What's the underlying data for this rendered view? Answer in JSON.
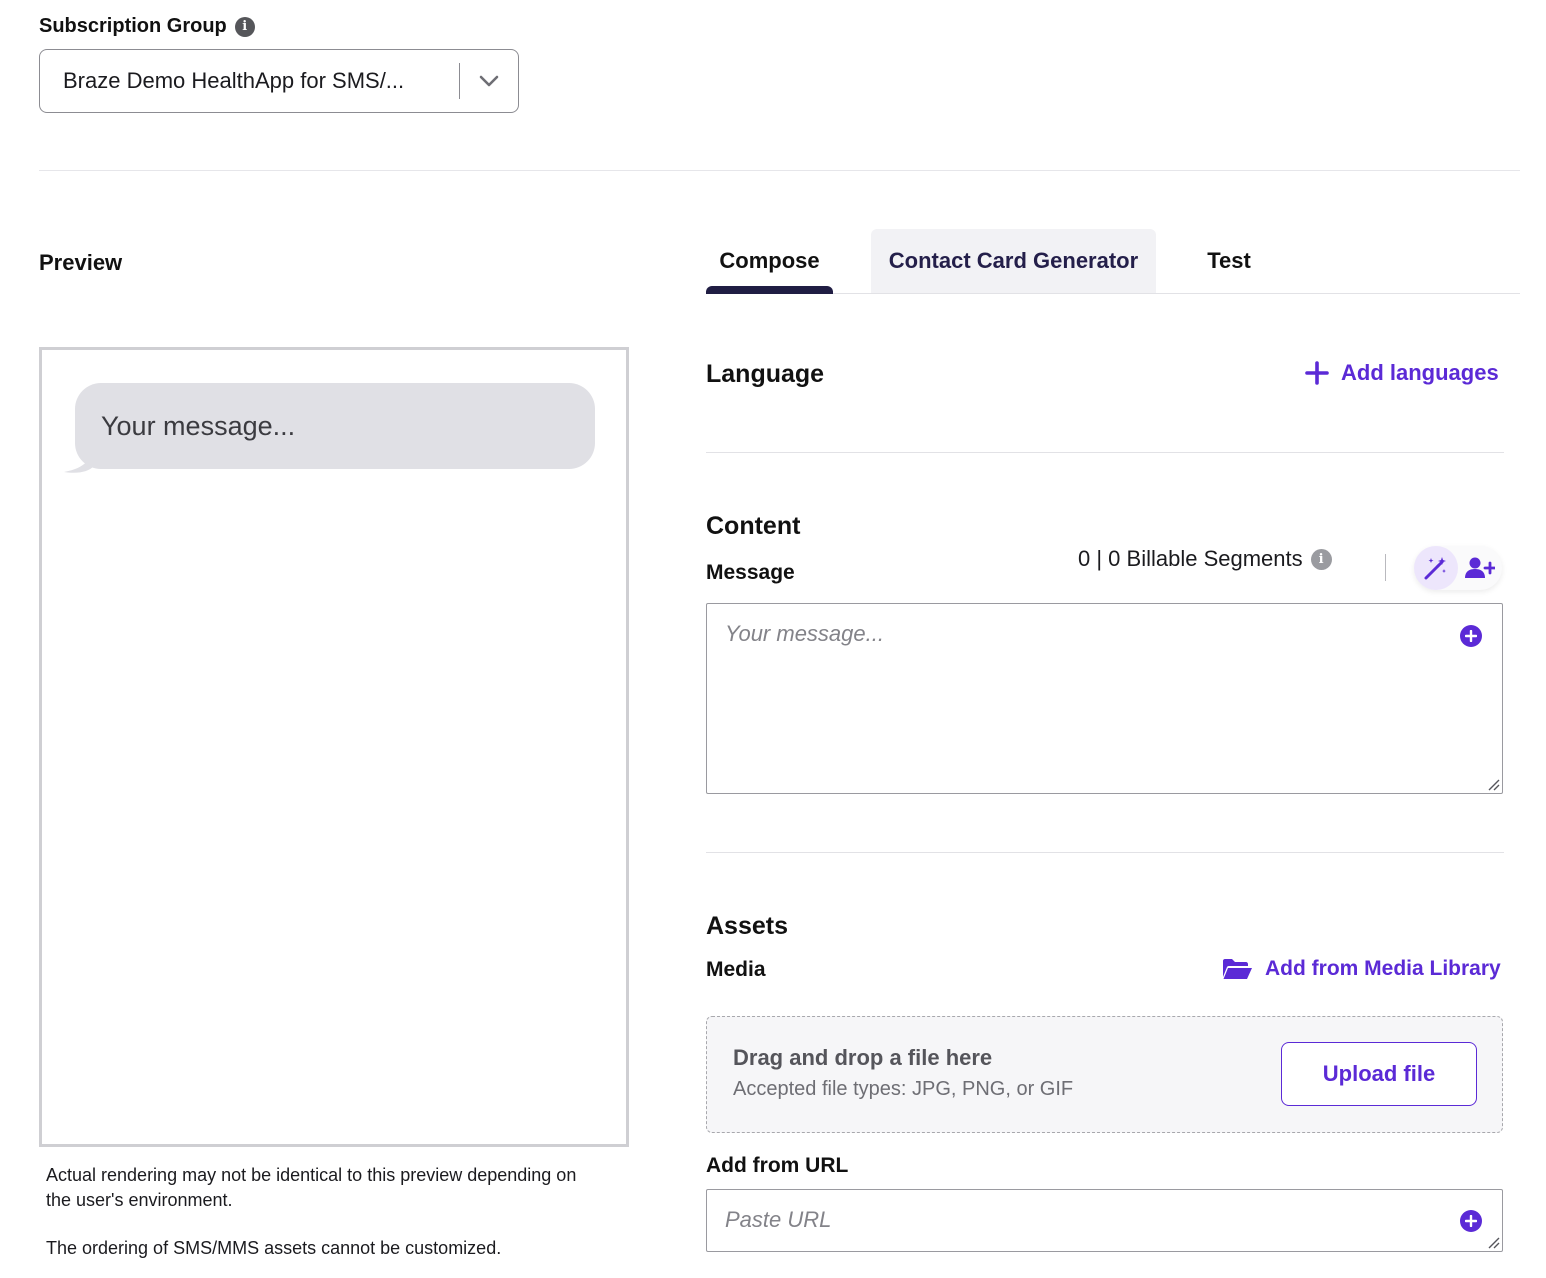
{
  "subscription": {
    "label": "Subscription Group",
    "info_glyph": "i",
    "selected": "Braze Demo HealthApp for SMS/..."
  },
  "preview": {
    "title": "Preview",
    "bubble_text": "Your message...",
    "disclaimer_1": "Actual rendering may not be identical to this preview depending on the user's environment.",
    "disclaimer_2": "The ordering of SMS/MMS assets cannot be customized."
  },
  "tabs": [
    {
      "label": "Compose",
      "active": true
    },
    {
      "label": "Contact Card Generator",
      "active": false
    },
    {
      "label": "Test",
      "active": false
    }
  ],
  "language": {
    "title": "Language",
    "add_label": "Add languages"
  },
  "content": {
    "title": "Content",
    "message_label": "Message",
    "segments": "0 | 0 Billable Segments",
    "message_placeholder": "Your message..."
  },
  "assets": {
    "title": "Assets",
    "media_label": "Media",
    "media_library_label": "Add from Media Library",
    "drop_title": "Drag and drop a file here",
    "drop_sub": "Accepted file types: JPG, PNG, or GIF",
    "upload_label": "Upload file",
    "url_label": "Add from URL",
    "url_placeholder": "Paste URL"
  },
  "colors": {
    "accent": "#5b2ad6",
    "tab_indicator": "#201d43",
    "bubble": "#e0e0e5"
  },
  "icons": [
    "info-icon",
    "chevron-down-icon",
    "plus-icon",
    "magic-wand-icon",
    "add-user-icon",
    "plus-circle-icon",
    "folder-open-icon",
    "resize-handle-icon"
  ]
}
